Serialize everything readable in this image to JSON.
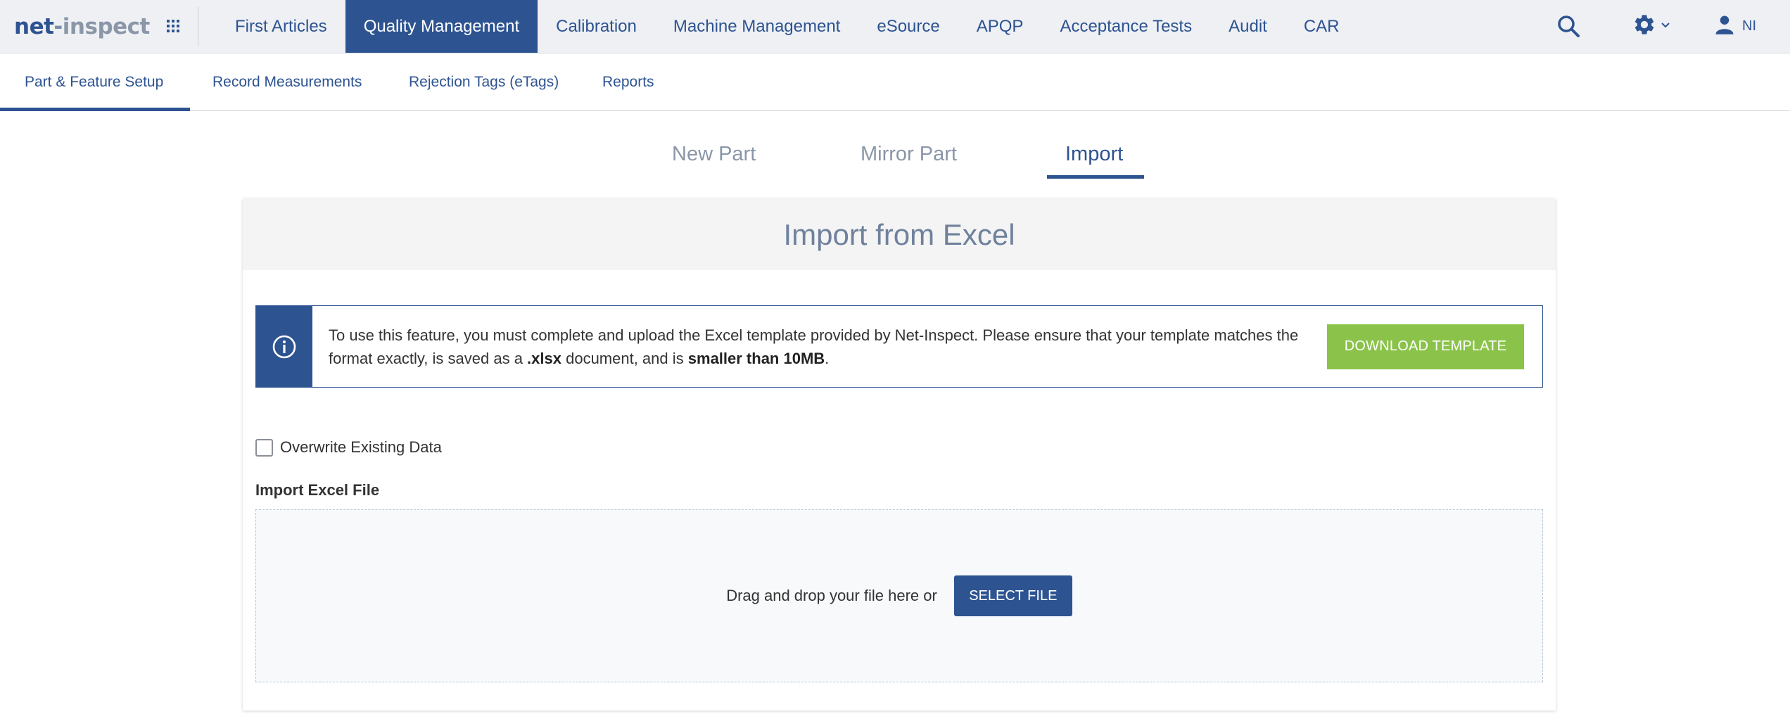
{
  "logo": {
    "part1": "net",
    "dash": "-",
    "part2": "inspect"
  },
  "topnav": {
    "items": [
      {
        "label": "First Articles",
        "active": false
      },
      {
        "label": "Quality Management",
        "active": true
      },
      {
        "label": "Calibration",
        "active": false
      },
      {
        "label": "Machine Management",
        "active": false
      },
      {
        "label": "eSource",
        "active": false
      },
      {
        "label": "APQP",
        "active": false
      },
      {
        "label": "Acceptance Tests",
        "active": false
      },
      {
        "label": "Audit",
        "active": false
      },
      {
        "label": "CAR",
        "active": false
      }
    ],
    "user_initials": "NI"
  },
  "subnav": {
    "items": [
      {
        "label": "Part & Feature Setup",
        "active": true
      },
      {
        "label": "Record Measurements",
        "active": false
      },
      {
        "label": "Rejection Tags (eTags)",
        "active": false
      },
      {
        "label": "Reports",
        "active": false
      }
    ]
  },
  "tabs": {
    "items": [
      {
        "label": "New Part",
        "active": false
      },
      {
        "label": "Mirror Part",
        "active": false
      },
      {
        "label": "Import",
        "active": true
      }
    ]
  },
  "card": {
    "title": "Import from Excel",
    "info": {
      "text_1": "To use this feature, you must complete and upload the Excel template provided by Net-Inspect. Please ensure that your template matches the format exactly, is saved as a ",
      "bold_1": ".xlsx",
      "text_2": " document, and is ",
      "bold_2": "smaller than 10MB",
      "text_3": ".",
      "download_label": "DOWNLOAD TEMPLATE"
    },
    "overwrite_label": "Overwrite Existing Data",
    "overwrite_checked": false,
    "import_label": "Import Excel File",
    "dropzone": {
      "text": "Drag and drop your file here or",
      "button_label": "SELECT FILE"
    }
  },
  "colors": {
    "brand": "#2d5391",
    "nav_bg": "#eef0f4",
    "download_button": "#8bc34a",
    "tab_inactive": "#8a96a8"
  }
}
